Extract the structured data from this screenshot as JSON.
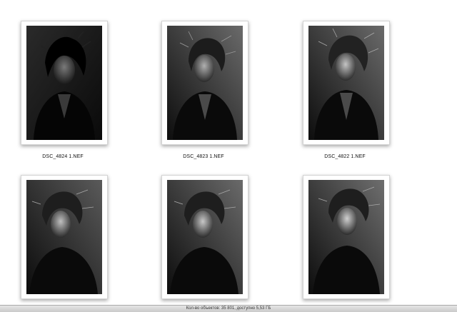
{
  "files": [
    {
      "name": "DSC_4824 1.NEF"
    },
    {
      "name": "DSC_4823 1.NEF"
    },
    {
      "name": "DSC_4822 1.NEF"
    },
    {
      "name": ""
    },
    {
      "name": ""
    },
    {
      "name": ""
    }
  ],
  "status_bar": {
    "text": "Кол-во объектов: 35 801, доступно 5,53 ГБ"
  },
  "colors": {
    "background": "#ffffff",
    "status_bar": "#d6d6d6",
    "photo_dark": "#111111"
  },
  "icons": [
    "photo-thumbnail-icon"
  ]
}
